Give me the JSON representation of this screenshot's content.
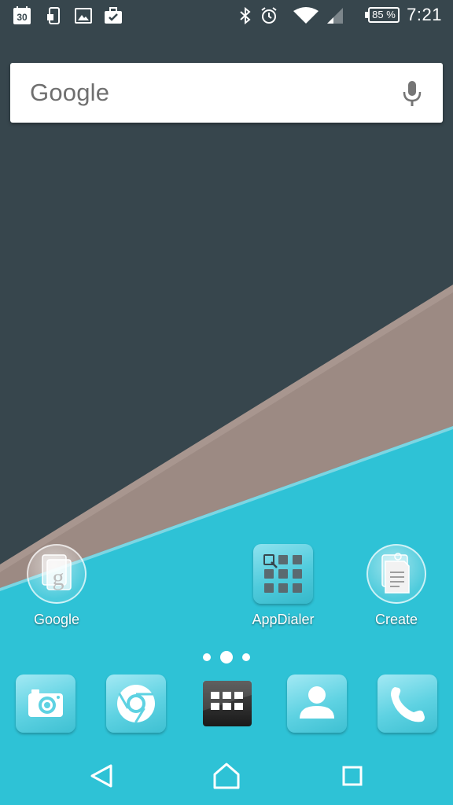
{
  "status_bar": {
    "calendar_day": "30",
    "battery_percent": "85 %",
    "time": "7:21",
    "icons": [
      "calendar-icon",
      "phone-sim-icon",
      "image-icon",
      "work-briefcase-icon",
      "bluetooth-icon",
      "alarm-icon",
      "wifi-icon",
      "cell-signal-icon",
      "battery-icon"
    ]
  },
  "search": {
    "logo_text": "Google",
    "mic_icon": "mic-icon"
  },
  "apps": [
    {
      "label": "Google",
      "icon": "google-folder-icon"
    },
    {
      "label": "AppDialer",
      "icon": "app-dialer-icon"
    },
    {
      "label": "Create",
      "icon": "create-folder-icon"
    }
  ],
  "page_indicator": {
    "pages": 3,
    "current": 2
  },
  "dock": [
    {
      "icon": "camera-icon"
    },
    {
      "icon": "chrome-icon"
    },
    {
      "icon": "app-drawer-icon"
    },
    {
      "icon": "contacts-icon"
    },
    {
      "icon": "phone-icon"
    }
  ],
  "nav": {
    "buttons": [
      "back-icon",
      "home-icon",
      "recents-icon"
    ]
  },
  "colors": {
    "wallpaper_dark": "#37464d",
    "wallpaper_taupe": "#9c8a83",
    "wallpaper_cyan": "#2ec2d6",
    "icon_tile": "#5ed2e2"
  }
}
